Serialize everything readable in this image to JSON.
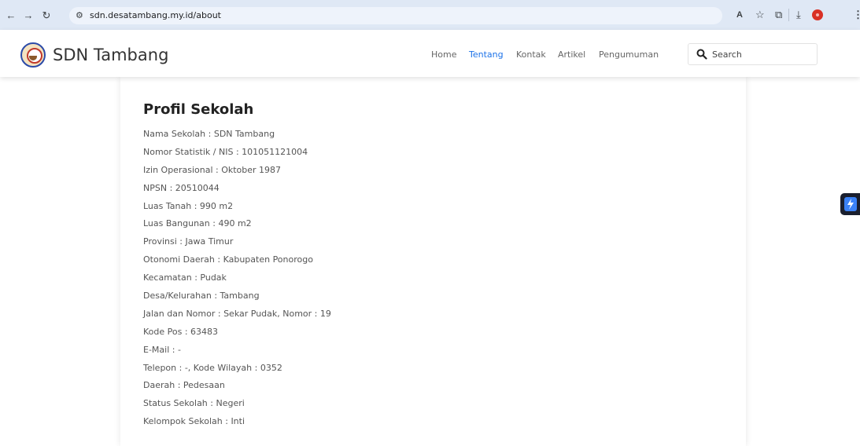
{
  "browser": {
    "url": "sdn.desatambang.my.id/about",
    "icons": [
      "back-icon",
      "forward-icon",
      "reload-icon",
      "site-settings-icon",
      "translate-icon",
      "star-icon",
      "extensions-icon",
      "download-icon",
      "profile-icon",
      "menu-icon"
    ]
  },
  "header": {
    "brand": "SDN Tambang",
    "nav": [
      {
        "label": "Home",
        "active": false
      },
      {
        "label": "Tentang",
        "active": true
      },
      {
        "label": "Kontak",
        "active": false
      },
      {
        "label": "Artikel",
        "active": false
      },
      {
        "label": "Pengumuman",
        "active": false
      }
    ],
    "search_placeholder": "Search"
  },
  "main": {
    "title": "Profil Sekolah",
    "items": [
      "Nama Sekolah : SDN Tambang",
      "Nomor Statistik / NIS : 101051121004",
      "Izin Operasional : Oktober 1987",
      "NPSN : 20510044",
      "Luas Tanah : 990 m2",
      "Luas Bangunan : 490 m2",
      "Provinsi : Jawa Timur",
      "Otonomi Daerah : Kabupaten Ponorogo",
      "Kecamatan : Pudak",
      "Desa/Kelurahan : Tambang",
      "Jalan dan Nomor : Sekar Pudak, Nomor : 19",
      "Kode Pos : 63483",
      "E-Mail : -",
      "Telepon : -, Kode Wilayah : 0352",
      "Daerah : Pedesaan",
      "Status Sekolah : Negeri",
      "Kelompok Sekolah : Inti"
    ]
  },
  "colors": {
    "accent": "#1e73e8",
    "chrome_bg": "#dfe8f5",
    "text": "#555555"
  }
}
